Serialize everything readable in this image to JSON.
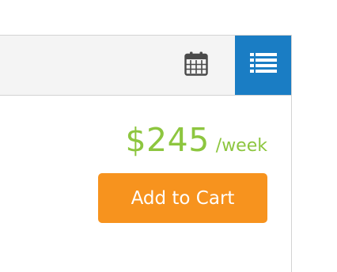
{
  "toolbar": {
    "calendar_icon": "calendar-icon",
    "list_icon": "list-view-icon",
    "list_button_color": "#1a7dc4"
  },
  "pricing": {
    "amount": "$245",
    "unit": "/week",
    "color": "#8dc63f"
  },
  "actions": {
    "add_to_cart_label": "Add to Cart",
    "add_to_cart_color": "#f7931e"
  }
}
